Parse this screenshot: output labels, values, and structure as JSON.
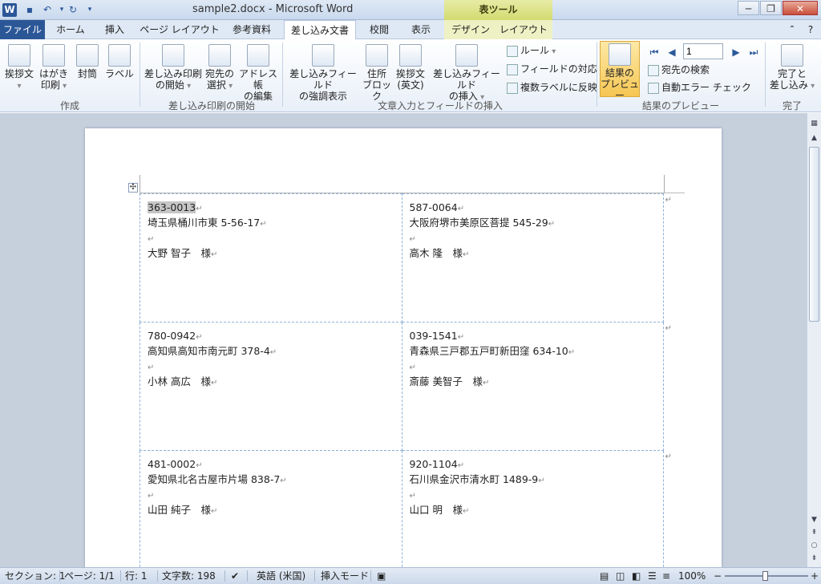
{
  "titlebar": {
    "app_icon": "W",
    "title": "sample2.docx - Microsoft Word",
    "contextual_header": "表ツール",
    "qat": [
      "save-icon",
      "undo-icon",
      "redo-icon",
      "customize-icon"
    ]
  },
  "tabs": {
    "file": "ファイル",
    "home": "ホーム",
    "insert": "挿入",
    "page_layout": "ページ レイアウト",
    "references": "参考資料",
    "mailings": "差し込み文書",
    "review": "校閲",
    "view": "表示",
    "design": "デザイン",
    "layout": "レイアウト"
  },
  "ribbon": {
    "create": {
      "label": "作成",
      "greeting": "挨拶文",
      "postcard": [
        "はがき",
        "印刷"
      ],
      "envelope": "封筒",
      "labels": "ラベル"
    },
    "start_merge": {
      "label": "差し込み印刷の開始",
      "start": [
        "差し込み印刷",
        "の開始"
      ],
      "select": [
        "宛先の",
        "選択"
      ],
      "edit": [
        "アドレス帳",
        "の編集"
      ]
    },
    "write_insert": {
      "label": "文章入力とフィールドの挿入",
      "highlight": [
        "差し込みフィールド",
        "の強調表示"
      ],
      "address_block": [
        "住所",
        "ブロック"
      ],
      "greeting_line": [
        "挨拶文",
        "(英文)"
      ],
      "insert_field": [
        "差し込みフィールド",
        "の挿入"
      ],
      "rules": "ルール",
      "match_fields": "フィールドの対応",
      "update_labels": "複数ラベルに反映"
    },
    "preview": {
      "label": "結果のプレビュー",
      "preview_button": [
        "結果の",
        "プレビュー"
      ],
      "record_value": "1",
      "find_recipient": "宛先の検索",
      "auto_check": "自動エラー チェック"
    },
    "finish": {
      "label": "完了",
      "finish_button": [
        "完了と",
        "差し込み"
      ]
    }
  },
  "labels": [
    {
      "postal": "363-0013",
      "address": "埼玉県桶川市東 5-56-17",
      "name": "大野 智子　様"
    },
    {
      "postal": "587-0064",
      "address": "大阪府堺市美原区菩提 545-29",
      "name": "高木 隆　様"
    },
    {
      "postal": "780-0942",
      "address": "高知県高知市南元町 378-4",
      "name": "小林 高広　様"
    },
    {
      "postal": "039-1541",
      "address": "青森県三戸郡五戸町新田窪 634-10",
      "name": "斎藤 美智子　様"
    },
    {
      "postal": "481-0002",
      "address": "愛知県北名古屋市片場 838-7",
      "name": "山田 純子　様"
    },
    {
      "postal": "920-1104",
      "address": "石川県金沢市清水町 1489-9",
      "name": "山口 明　様"
    }
  ],
  "paragraph_mark": "↵",
  "cell_mark": "↵",
  "status": {
    "section": "セクション: 1",
    "page": "ページ: 1/1",
    "line": "行: 1",
    "wordcount": "文字数: 198",
    "language": "英語 (米国)",
    "mode": "挿入モード",
    "zoom": "100%",
    "zoom_minus": "−",
    "zoom_plus": "+"
  }
}
